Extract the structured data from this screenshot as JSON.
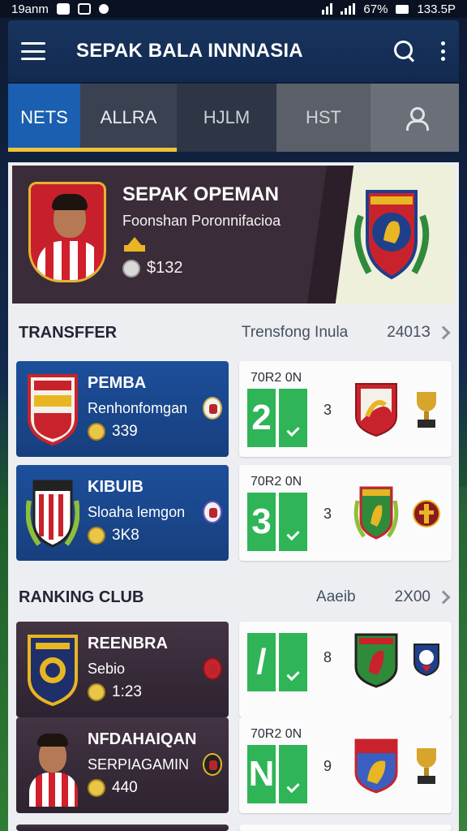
{
  "status_bar": {
    "time": "19anm",
    "battery": "67%",
    "clock": "133.5P"
  },
  "app_bar": {
    "title": "SEPAK BALA INNNASIA"
  },
  "tabs": [
    {
      "label": "NETS",
      "active": true
    },
    {
      "label": "ALLRA"
    },
    {
      "label": "HJLM"
    },
    {
      "label": "HST"
    }
  ],
  "hero": {
    "name": "SEPAK OPEMAN",
    "subtitle": "Foonshan Poronnifacioa",
    "stat": "$132"
  },
  "transfer_section": {
    "title": "TRANSFFER",
    "mid": "Trensfong Inula",
    "year": "2401З"
  },
  "transfers": [
    {
      "name": "PEMBA",
      "sub": "Renhonfomgan",
      "stat": "339",
      "right_label": "70R2 0N",
      "score": "2",
      "mid": "3"
    },
    {
      "name": "KIBUIB",
      "sub": "Sloaha lemgon",
      "stat": "3K8",
      "right_label": "70R2 0N",
      "score": "3",
      "mid": "3"
    }
  ],
  "ranking_section": {
    "title": "RANKING CLUB",
    "mid": "Aaeib",
    "year": "2X00"
  },
  "rankings": [
    {
      "name": "REENBRA",
      "sub": "Sebio",
      "stat": "1:23",
      "right_label": "",
      "score": "/",
      "mid": "8"
    },
    {
      "name": "NFDAHAIQAN",
      "sub": "SERPIAGAMIN",
      "stat": "440",
      "right_label": "70R2 0N",
      "score": "N",
      "mid": "9"
    }
  ],
  "colors": {
    "primary": "#18345f",
    "active_tab": "#1a5fb0",
    "accent": "#f0c23a",
    "score_green": "#2fb457",
    "card_blue": "#1d4f9b",
    "card_dark": "#3b2c39"
  }
}
